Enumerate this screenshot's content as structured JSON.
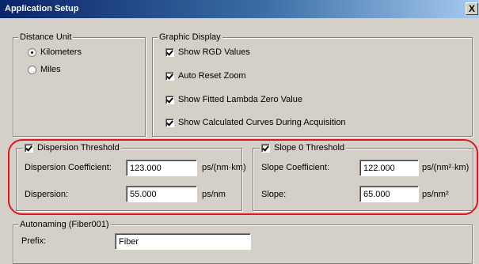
{
  "window": {
    "title": "Application Setup",
    "close_label": "X"
  },
  "distance_unit": {
    "legend": "Distance Unit",
    "options": [
      {
        "label": "Kilometers",
        "selected": true
      },
      {
        "label": "Miles",
        "selected": false
      }
    ]
  },
  "graphic_display": {
    "legend": "Graphic Display",
    "options": [
      {
        "label": "Show RGD Values",
        "checked": true
      },
      {
        "label": "Auto Reset Zoom",
        "checked": true
      },
      {
        "label": "Show Fitted Lambda Zero Value",
        "checked": true
      },
      {
        "label": "Show Calculated Curves During Acquisition",
        "checked": true
      }
    ]
  },
  "dispersion_threshold": {
    "legend": "Dispersion Threshold",
    "enabled": true,
    "coefficient_label": "Dispersion Coefficient:",
    "coefficient_value": "123.000",
    "coefficient_unit": "ps/(nm·km)",
    "dispersion_label": "Dispersion:",
    "dispersion_value": "55.000",
    "dispersion_unit": "ps/nm"
  },
  "slope_threshold": {
    "legend": "Slope 0 Threshold",
    "enabled": true,
    "coefficient_label": "Slope Coefficient:",
    "coefficient_value": "122.000",
    "coefficient_unit": "ps/(nm²·km)",
    "slope_label": "Slope:",
    "slope_value": "65.000",
    "slope_unit": "ps/nm²"
  },
  "autonaming": {
    "legend": "Autonaming (Fiber001)",
    "prefix_label": "Prefix:",
    "prefix_value": "Fiber"
  },
  "colors": {
    "highlight": "#e0141e",
    "titlebar": "#0a246a"
  }
}
